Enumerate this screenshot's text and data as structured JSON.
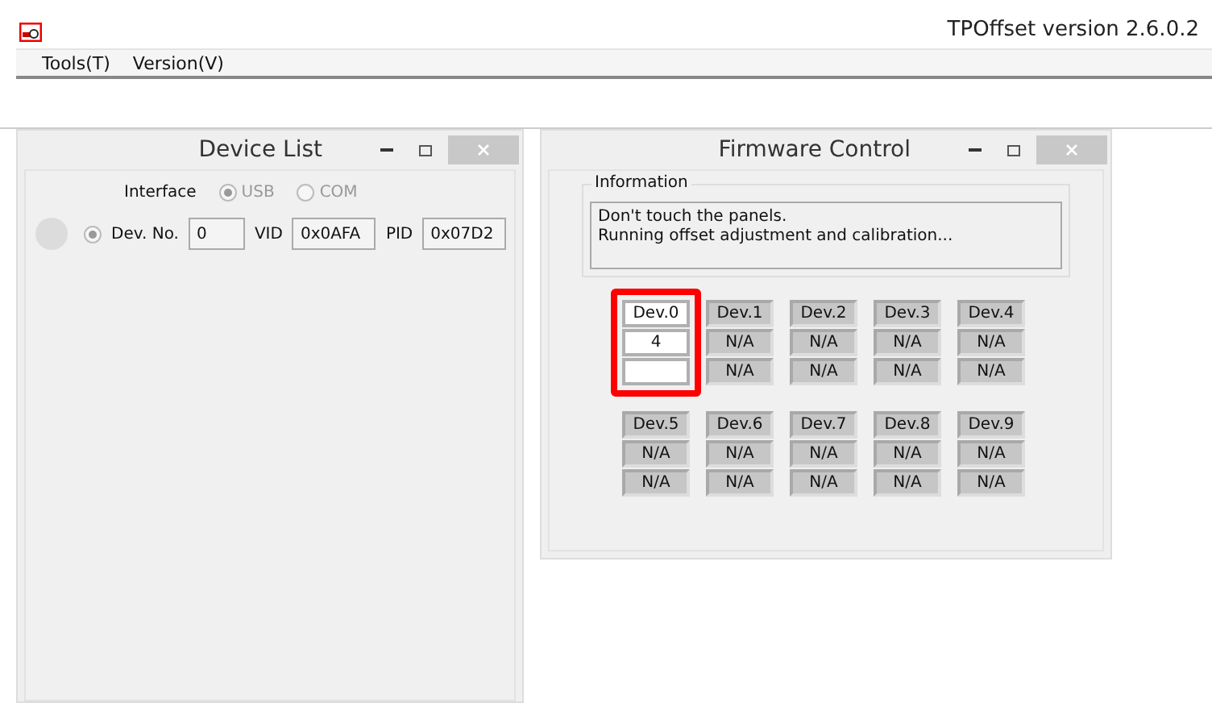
{
  "app": {
    "title": "TPOffset version 2.6.0.2"
  },
  "menu": [
    "Tools(T)",
    "Version(V)"
  ],
  "device_list": {
    "title": "Device List",
    "interface_label": "Interface",
    "interfaces": [
      {
        "label": "USB",
        "selected": true
      },
      {
        "label": "COM",
        "selected": false
      }
    ],
    "device": {
      "selected": true,
      "dev_no_label": "Dev. No.",
      "dev_no": "0",
      "vid_label": "VID",
      "vid": "0x0AFA",
      "pid_label": "PID",
      "pid": "0x07D2"
    }
  },
  "firmware_control": {
    "title": "Firmware Control",
    "info_title": "Information",
    "info_lines": [
      "Don't touch the panels.",
      "Running offset adjustment and calibration..."
    ],
    "devices": [
      {
        "name": "Dev.0",
        "values": [
          "4"
        ],
        "active": true,
        "highlighted": true
      },
      {
        "name": "Dev.1",
        "values": [
          "N/A",
          "N/A"
        ],
        "active": false,
        "highlighted": false
      },
      {
        "name": "Dev.2",
        "values": [
          "N/A",
          "N/A"
        ],
        "active": false,
        "highlighted": false
      },
      {
        "name": "Dev.3",
        "values": [
          "N/A",
          "N/A"
        ],
        "active": false,
        "highlighted": false
      },
      {
        "name": "Dev.4",
        "values": [
          "N/A",
          "N/A"
        ],
        "active": false,
        "highlighted": false
      },
      {
        "name": "Dev.5",
        "values": [
          "N/A",
          "N/A"
        ],
        "active": false,
        "highlighted": false
      },
      {
        "name": "Dev.6",
        "values": [
          "N/A",
          "N/A"
        ],
        "active": false,
        "highlighted": false
      },
      {
        "name": "Dev.7",
        "values": [
          "N/A",
          "N/A"
        ],
        "active": false,
        "highlighted": false
      },
      {
        "name": "Dev.8",
        "values": [
          "N/A",
          "N/A"
        ],
        "active": false,
        "highlighted": false
      },
      {
        "name": "Dev.9",
        "values": [
          "N/A",
          "N/A"
        ],
        "active": false,
        "highlighted": false
      }
    ]
  }
}
